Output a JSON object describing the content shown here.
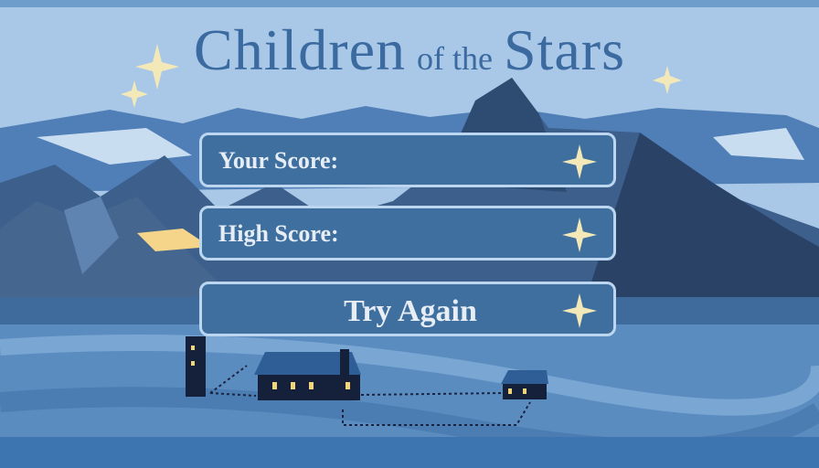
{
  "title": {
    "word1": "Children",
    "word2": "of the",
    "word3": "Stars"
  },
  "score_panel": {
    "label": "Your Score:",
    "value": ""
  },
  "high_score_panel": {
    "label": "High Score:",
    "value": ""
  },
  "try_again": {
    "label": "Try Again"
  },
  "colors": {
    "accent": "#3f6f9f",
    "border": "#bcd6ef",
    "star": "#f3e9b8",
    "title": "#3b6aa0"
  },
  "icons": [
    "sparkle-star-icon"
  ]
}
